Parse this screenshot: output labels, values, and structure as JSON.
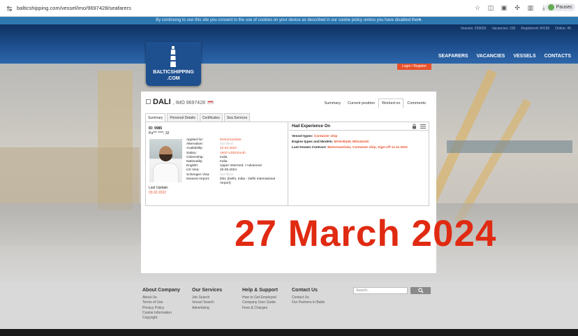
{
  "browser": {
    "url": "balticshipping.com/vessel/imo/9697428/seafarers",
    "profile_label": "Pausec"
  },
  "cookie_bar": {
    "text": "By continuing to use this site you consent to the use of cookies on your device as described in our cookie policy unless you have disabled them.",
    "close": "×"
  },
  "stats": {
    "vessels": "Vessels: 259695",
    "vacancies": "Vacancies: 236",
    "registered": "Registered: 84199",
    "online": "Online: 45"
  },
  "nav": {
    "items": [
      "SEAFARERS",
      "VACANCIES",
      "VESSELS",
      "CONTACTS"
    ]
  },
  "logo": {
    "line1": "BALTICSHIPPING",
    "line2": ".COM"
  },
  "login": {
    "label": "Login / Register"
  },
  "vessel": {
    "name": "DALI",
    "imo": ", IMO 9697428"
  },
  "top_tabs": [
    "Summary",
    "Current position",
    "Worked on",
    "Comments"
  ],
  "sub_tabs": [
    "Summary",
    "Personal Details",
    "Certificates",
    "Sea Services"
  ],
  "seafarer": {
    "id": "ID: 9985",
    "name": "Pa*** ****, 32",
    "last_update_label": "Last Update:",
    "last_update": "03.02.2022",
    "fields": [
      {
        "label": "Applied for:",
        "value": "Motormanlolar",
        "style": "orange"
      },
      {
        "label": "Alternative:",
        "value": "Not filled",
        "style": "grey"
      },
      {
        "label": "Availability:",
        "value": "22.02.2022",
        "style": "orange"
      },
      {
        "label": "Salary:",
        "value": "1600 USD/month",
        "style": "orange"
      },
      {
        "label": "Citizenship:",
        "value": "India",
        "style": ""
      },
      {
        "label": "Nationality:",
        "value": "India",
        "style": ""
      },
      {
        "label": "English:",
        "value": "Upper Intermed. / Advanced",
        "style": ""
      },
      {
        "label": "US Visa:",
        "value": "20.09.2024",
        "style": ""
      },
      {
        "label": "Schengen Visa:",
        "value": "Not filled",
        "style": "grey"
      },
      {
        "label": "Nearest Airport:",
        "value": "DEL (Delhi, India - Delhi International",
        "style": ""
      },
      {
        "label": "",
        "value": "Airport)",
        "style": ""
      }
    ]
  },
  "experience": {
    "title": "Had Experience On",
    "vessel_types_label": "Vessel types:",
    "vessel_types": "Container ship",
    "engine_label": "Engine types and Models:",
    "engine": "MAN-B&W, Mitsubishi",
    "contract_label": "Last Known Contract:",
    "contract": "Motormanlolar, Container ship, Sign-off 11.11.2021"
  },
  "overlay": {
    "date": "27 March 2024"
  },
  "footer": {
    "about": {
      "title": "About Company",
      "links": [
        "About Us",
        "Terms of Use",
        "Privacy Policy",
        "Cookie Information",
        "Copyright"
      ]
    },
    "services": {
      "title": "Our Services",
      "links": [
        "Job Search",
        "Vessel Search",
        "Advertising"
      ]
    },
    "help": {
      "title": "Help & Support",
      "links": [
        "How to Get Employed",
        "Company User Guide",
        "Fees & Charges"
      ]
    },
    "contact": {
      "title": "Contact Us",
      "links": [
        "Contact Us",
        "Our Partners in Baltic"
      ]
    },
    "search_placeholder": "Search.."
  },
  "colors": {
    "accent": "#e8512a",
    "header_blue": "#1e4f8f",
    "cookie_blue": "#2e78b0",
    "date_red": "#e02a12"
  }
}
